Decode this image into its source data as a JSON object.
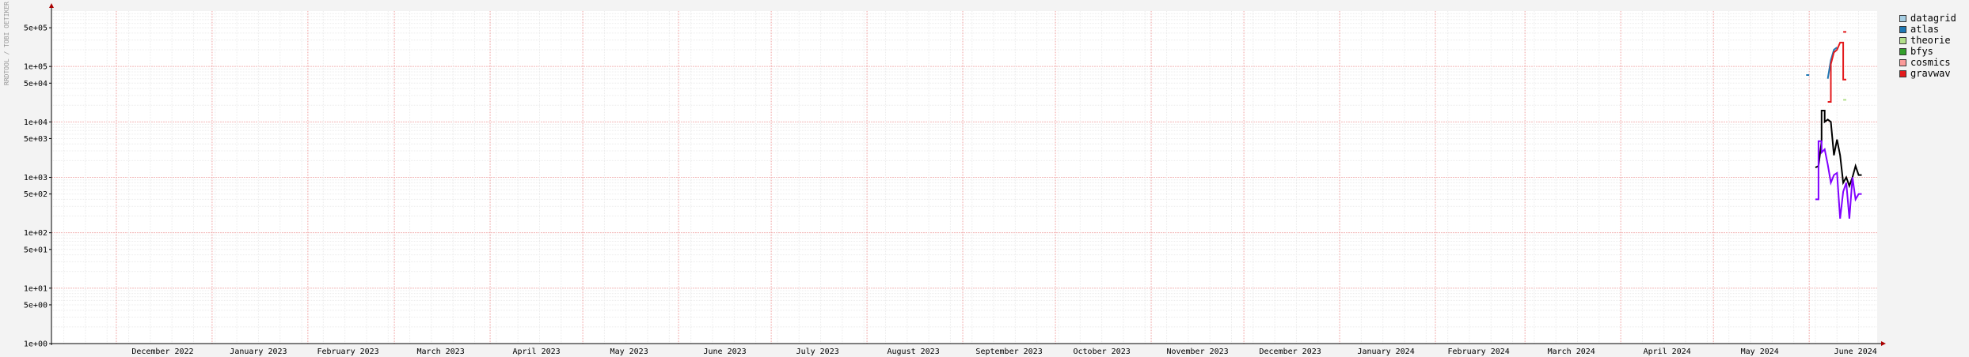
{
  "chart_data": {
    "type": "line",
    "ylabel": "RRDTOOL / TOBI OETIKER",
    "yscale": "log",
    "ylim": [
      1,
      1000000
    ],
    "y_ticks": [
      "5e+05",
      "1e+05",
      "5e+04",
      "1e+04",
      "5e+03",
      "1e+03",
      "5e+02",
      "1e+02",
      "5e+01",
      "1e+01",
      "5e+00",
      "1e+00"
    ],
    "y_tick_values": [
      500000,
      100000,
      50000,
      10000,
      5000,
      1000,
      500,
      100,
      50,
      10,
      5,
      1
    ],
    "x_range": [
      "2022-11-10",
      "2024-06-23"
    ],
    "x_labels": [
      {
        "label": "December 2022",
        "date": "2022-12-16"
      },
      {
        "label": "January 2023",
        "date": "2023-01-16"
      },
      {
        "label": "February 2023",
        "date": "2023-02-14"
      },
      {
        "label": "March 2023",
        "date": "2023-03-16"
      },
      {
        "label": "April 2023",
        "date": "2023-04-16"
      },
      {
        "label": "May 2023",
        "date": "2023-05-16"
      },
      {
        "label": "June 2023",
        "date": "2023-06-16"
      },
      {
        "label": "July 2023",
        "date": "2023-07-16"
      },
      {
        "label": "August 2023",
        "date": "2023-08-16"
      },
      {
        "label": "September 2023",
        "date": "2023-09-16"
      },
      {
        "label": "October 2023",
        "date": "2023-10-16"
      },
      {
        "label": "November 2023",
        "date": "2023-11-16"
      },
      {
        "label": "December 2023",
        "date": "2023-12-16"
      },
      {
        "label": "January 2024",
        "date": "2024-01-16"
      },
      {
        "label": "February 2024",
        "date": "2024-02-15"
      },
      {
        "label": "March 2024",
        "date": "2024-03-16"
      },
      {
        "label": "April 2024",
        "date": "2024-04-16"
      },
      {
        "label": "May 2024",
        "date": "2024-05-16"
      },
      {
        "label": "June 2024",
        "date": "2024-06-16"
      }
    ],
    "grid": true,
    "legend_position": "right",
    "legend": [
      {
        "name": "datagrid",
        "color": "#a6cee3"
      },
      {
        "name": "atlas",
        "color": "#1f78b4"
      },
      {
        "name": "theorie",
        "color": "#b2df8a"
      },
      {
        "name": "bfys",
        "color": "#33a02c"
      },
      {
        "name": "cosmics",
        "color": "#fb9a99"
      },
      {
        "name": "gravwav",
        "color": "#e31a1c"
      }
    ],
    "series": [
      {
        "name": "atlas",
        "color": "#1f78b4",
        "points": [
          [
            "2024-05-31",
            70000
          ],
          [
            "2024-06-01",
            70000
          ]
        ]
      },
      {
        "name": "atlas",
        "color": "#1f78b4",
        "points": [
          [
            "2024-06-07",
            60000
          ],
          [
            "2024-06-08",
            130000
          ],
          [
            "2024-06-09",
            200000
          ],
          [
            "2024-06-10",
            220000
          ]
        ]
      },
      {
        "name": "gravwav",
        "color": "#e31a1c",
        "points": [
          [
            "2024-06-07",
            23000
          ],
          [
            "2024-06-08",
            23000
          ],
          [
            "2024-06-08",
            110000
          ],
          [
            "2024-06-09",
            180000
          ],
          [
            "2024-06-10",
            200000
          ],
          [
            "2024-06-11",
            270000
          ],
          [
            "2024-06-12",
            270000
          ],
          [
            "2024-06-12",
            58000
          ],
          [
            "2024-06-13",
            58000
          ]
        ]
      },
      {
        "name": "gravwav",
        "color": "#e31a1c",
        "points": [
          [
            "2024-06-12",
            420000
          ],
          [
            "2024-06-13",
            420000
          ]
        ]
      },
      {
        "name": "theorie",
        "color": "#b2df8a",
        "points": [
          [
            "2024-06-12",
            25000
          ],
          [
            "2024-06-13",
            25000
          ]
        ]
      },
      {
        "color": "#000000",
        "points": [
          [
            "2024-06-03",
            1500
          ],
          [
            "2024-06-04",
            1600
          ],
          [
            "2024-06-05",
            4500
          ],
          [
            "2024-06-05",
            16000
          ],
          [
            "2024-06-06",
            16000
          ],
          [
            "2024-06-06",
            10000
          ],
          [
            "2024-06-07",
            11000
          ],
          [
            "2024-06-08",
            10000
          ],
          [
            "2024-06-09",
            2500
          ],
          [
            "2024-06-10",
            4800
          ],
          [
            "2024-06-11",
            2500
          ],
          [
            "2024-06-12",
            800
          ],
          [
            "2024-06-13",
            1000
          ],
          [
            "2024-06-14",
            700
          ],
          [
            "2024-06-15",
            1000
          ],
          [
            "2024-06-16",
            1600
          ],
          [
            "2024-06-17",
            1100
          ],
          [
            "2024-06-18",
            1100
          ]
        ]
      },
      {
        "color": "#8000ff",
        "points": [
          [
            "2024-06-03",
            400
          ],
          [
            "2024-06-04",
            400
          ],
          [
            "2024-06-04",
            4500
          ],
          [
            "2024-06-05",
            4500
          ],
          [
            "2024-06-05",
            2800
          ],
          [
            "2024-06-06",
            3200
          ],
          [
            "2024-06-07",
            1700
          ],
          [
            "2024-06-08",
            800
          ],
          [
            "2024-06-09",
            1100
          ],
          [
            "2024-06-10",
            1200
          ],
          [
            "2024-06-11",
            180
          ],
          [
            "2024-06-12",
            550
          ],
          [
            "2024-06-13",
            800
          ],
          [
            "2024-06-14",
            180
          ],
          [
            "2024-06-15",
            1000
          ],
          [
            "2024-06-16",
            400
          ],
          [
            "2024-06-17",
            500
          ],
          [
            "2024-06-18",
            500
          ]
        ]
      }
    ]
  }
}
